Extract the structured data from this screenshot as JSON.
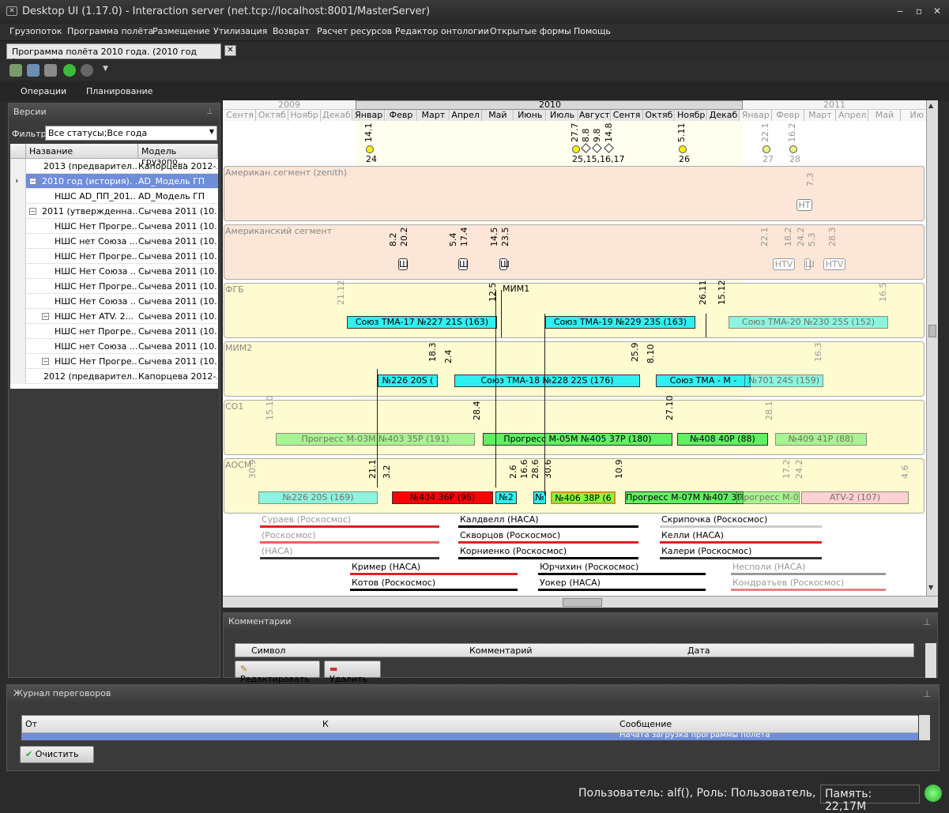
{
  "window": {
    "title": "Desktop UI (1.17.0) - Interaction server (net.tcp://localhost:8001/MasterServer)"
  },
  "menu": [
    "Грузопоток",
    "Программа полёта",
    "Размещение",
    "Утилизация",
    "Возврат",
    "Расчет ресурсов",
    "Редактор онтологии",
    "Открытые формы",
    "Помощь"
  ],
  "doc_tab": {
    "label": "Программа полёта 2010 года. (2010 год (история))",
    "close": "✕"
  },
  "ribbon": {
    "tabs": [
      "Операции",
      "Планирование"
    ]
  },
  "versions": {
    "title": "Версии",
    "filter_label": "Фильтр",
    "filter_value": "Все статусы;Все года",
    "col_name": "Название",
    "col_model": "Модель грузопо...",
    "rows": [
      {
        "name": "2013 (предварител...",
        "model": "Капорцева 2012-..."
      },
      {
        "name": "2010 год (история). ...",
        "model": "AD_Модель ГП"
      },
      {
        "name": "НШС AD_ПП_201...",
        "model": "AD_Модель ГП"
      },
      {
        "name": "2011 (утвержденна...",
        "model": "Сычева 2011 (10..."
      },
      {
        "name": "НШС Нет Прогре...",
        "model": "Сычева 2011 (10..."
      },
      {
        "name": "НШС нет Союза ...",
        "model": "Сычева 2011 (10..."
      },
      {
        "name": "НШС Нет Прогре...",
        "model": "Сычева 2011 (10..."
      },
      {
        "name": "НШС Нет Союза ...",
        "model": "Сычева 2011 (10..."
      },
      {
        "name": "НШС Нет Прогре...",
        "model": "Сычева 2011 (10..."
      },
      {
        "name": "НШС Нет Союза ...",
        "model": "Сычева 2011 (10..."
      },
      {
        "name": "НШС Нет ATV. 2...",
        "model": "Сычева 2011 (10..."
      },
      {
        "name": "НШС нет Прогре...",
        "model": "Сычева 2011 (10..."
      },
      {
        "name": "НШС нет Союза ...",
        "model": "Сычева 2011 (10..."
      },
      {
        "name": "НШС Нет Прогре...",
        "model": "Сычева 2011 (10..."
      },
      {
        "name": "2012 (предварител...",
        "model": "Капорцева 2012-..."
      }
    ]
  },
  "timeline": {
    "years": [
      "2009",
      "2010",
      "2011"
    ],
    "months": [
      "Сентя",
      "Октяб",
      "Ноябр",
      "Декаб",
      "Январ",
      "Февр",
      "Март",
      "Апрел",
      "Май",
      "Июнь",
      "Июль",
      "Август",
      "Сентя",
      "Октяб",
      "Ноябр",
      "Декаб",
      "Январ",
      "Февр",
      "Март",
      "Апрел",
      "Май",
      "Ию"
    ],
    "events": [
      {
        "date": "14.1",
        "num": "24"
      },
      {
        "date": "27.7",
        "num": "25,15,16,17"
      },
      {
        "date": "8.8"
      },
      {
        "date": "9.8"
      },
      {
        "date": "14.8"
      },
      {
        "date": "5.11",
        "num": "26"
      },
      {
        "date": "22.1",
        "num": "27"
      },
      {
        "date": "16.2",
        "num": "28"
      }
    ],
    "lanes": [
      {
        "label": "Американ.сегмент (zenith)"
      },
      {
        "label": "Американский сегмент"
      },
      {
        "label": "ФГБ"
      },
      {
        "label": "МИМ2"
      },
      {
        "label": "СО1"
      },
      {
        "label": "АОСМ"
      }
    ],
    "marks": {
      "ht": "HT",
      "htv1": "HTV",
      "htv2": "HTV",
      "sh": "Ш",
      "l": "Ш",
      "d_7_3": "7.3",
      "d_8_2": "8.2",
      "d_20_2": "20.2",
      "d_5_4": "5.4",
      "d_17_4": "17.4",
      "d_14_5": "14.5",
      "d_23_5": "23.5",
      "d_22_1": "22.1",
      "d_18_2": "18.2",
      "d_24_2": "24.2",
      "d_5_3": "5.3",
      "d_28_3": "28.3",
      "d_21_12": "21.12",
      "d_12_5": "12.5",
      "mim1": "МИМ1",
      "d_26_11": "26.11",
      "d_15_12": "15.12",
      "d_16_5": "16.5",
      "d_18_3": "18.3",
      "d_2_4": "2.4",
      "d_25_9": "25.9",
      "d_8_10": "8.10",
      "d_16_3": "16.3",
      "d_15_10": "15.10",
      "d_28_4": "28.4",
      "d_27_10": "27.10",
      "d_28_1": "28.1",
      "d_30_9": "30.9",
      "d_21_1": "21.1",
      "d_3_2": "3.2",
      "d_2_6": "2.6",
      "d_16_6": "16.6",
      "d_28_6": "28.6",
      "d_30_6": "30.6",
      "d_10_9": "10.9",
      "d_17_2": "17.2",
      "d_24_2b": "24.2",
      "d_4_6": "4.6"
    },
    "bars": {
      "tma17": "Союз ТМА-17 №227 21S (163)",
      "tma19": "Союз ТМА-19 №229 23S (163)",
      "tma20": "Союз ТМА-20 №230 25S (152)",
      "b226a": "№226 20S (",
      "tma18": "Союз ТМА-18 №228 22S (176)",
      "tmax": "Союз ТМА -    М -",
      "b701": "№701 24S (159)",
      "pm03": "Прогресс М-03М №403 35Р (191)",
      "pm05": "Прогресс М-05М №405 37Р (180)",
      "b408": "№408 40Р (88)",
      "b409": "№409 41Р (88)",
      "b226b": "№226 20S (169)",
      "b404": "№404 36Р (96)",
      "bn2": "№2",
      "bn": "№",
      "b406": "№406 38Р (6",
      "pm07": "Прогресс М-07М №407 39Р (163)",
      "atv2": "ATV-2 (107)"
    },
    "crew": [
      "Сураев (Роскосмос)",
      "(Роскосмос)",
      "(НАСА)",
      "Калдвелл (НАСА)",
      "Скворцов (Роскосмос)",
      "Корниенко (Роскосмос)",
      "Скрипочка (Роскосмос)",
      "Келли (НАСА)",
      "Калери (Роскосмос)",
      "Кример (НАСА)",
      "Котов (Роскосмос)",
      "Юрчихин (Роскосмос)",
      "Уокер (НАСА)",
      "Несполи (НАСА)",
      "Кондратьев (Роскосмос)"
    ]
  },
  "comments": {
    "title": "Комментарии",
    "cols": [
      "Символ",
      "Комментарий",
      "Дата"
    ],
    "edit": "Редактировать",
    "delete": "Удалить"
  },
  "journal": {
    "title": "Журнал переговоров",
    "cols": [
      "От",
      "К",
      "Сообщение"
    ],
    "row_msg": "Начата загрузка программы полёта",
    "clear": "Очистить"
  },
  "status": {
    "user": "Пользователь:  alf(), Роль:  Пользователь,",
    "memory": "Память:  22,17M"
  }
}
